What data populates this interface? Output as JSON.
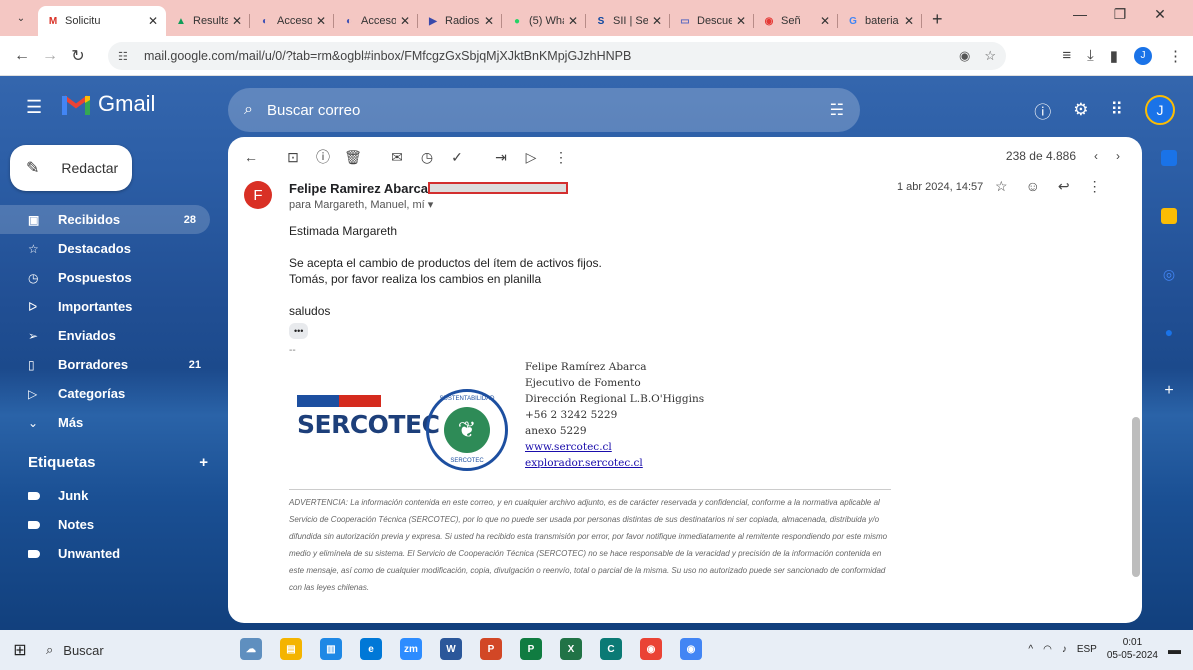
{
  "browser": {
    "tabs": [
      {
        "label": "Solicitu",
        "favicon": "gmail",
        "active": true
      },
      {
        "label": "Resulta",
        "favicon": "drive-icon"
      },
      {
        "label": "Acceso",
        "favicon": "swirl-icon"
      },
      {
        "label": "Acceso",
        "favicon": "swirl-icon"
      },
      {
        "label": "Radios",
        "favicon": "play-icon"
      },
      {
        "label": "(5) Wha",
        "favicon": "whatsapp-icon"
      },
      {
        "label": "SII | Ser",
        "favicon": "sii-icon"
      },
      {
        "label": "Descue",
        "favicon": "tag-icon"
      },
      {
        "label": "Señ",
        "favicon": "radio-icon"
      },
      {
        "label": "bateria",
        "favicon": "google-icon"
      }
    ],
    "url": "mail.google.com/mail/u/0/?tab=rm&ogbl#inbox/FMfcgzGxSbjqMjXJktBnKMpjGJzhHNPB"
  },
  "gmail": {
    "logo_text": "Gmail",
    "search_placeholder": "Buscar correo",
    "compose_label": "Redactar",
    "nav": [
      {
        "label": "Recibidos",
        "count": "28",
        "icon": "inbox-icon",
        "glyph": "▣",
        "active": true
      },
      {
        "label": "Destacados",
        "count": "",
        "icon": "star-icon",
        "glyph": "☆"
      },
      {
        "label": "Pospuestos",
        "count": "",
        "icon": "clock-icon",
        "glyph": "◷"
      },
      {
        "label": "Importantes",
        "count": "",
        "icon": "important-icon",
        "glyph": "ᐅ"
      },
      {
        "label": "Enviados",
        "count": "",
        "icon": "send-icon",
        "glyph": "➢"
      },
      {
        "label": "Borradores",
        "count": "21",
        "icon": "draft-icon",
        "glyph": "▯"
      },
      {
        "label": "Categorías",
        "count": "",
        "icon": "category-icon",
        "glyph": "▷"
      },
      {
        "label": "Más",
        "count": "",
        "icon": "chevron-down-icon",
        "glyph": "⌄"
      }
    ],
    "labels_heading": "Etiquetas",
    "labels": [
      "Junk",
      "Notes",
      "Unwanted"
    ],
    "pager": "238 de 4.886"
  },
  "message": {
    "sender_initial": "F",
    "sender_name": "Felipe Ramirez Abarca",
    "recipients": "para Margareth, Manuel, mí ▾",
    "date": "1 abr 2024, 14:57",
    "greeting": "Estimada Margareth",
    "line1": "Se acepta el cambio de productos del ítem de activos fijos.",
    "line2": "Tomás, por favor realiza los cambios en planilla",
    "closing": "saludos",
    "dash": "--",
    "signature": {
      "name": "Felipe Ramírez Abarca",
      "title": "Ejecutivo de Fomento",
      "office": "Dirección Regional L.B.O'Higgins",
      "phone": "+56 2 3242 5229",
      "extension": "anexo 5229",
      "web1": "www.sercotec.cl",
      "web2": "explorador.sercotec.cl",
      "logo_word": "SERCOTEC",
      "seal_top": "SUSTENTABILIDAD",
      "seal_bottom": "SERCOTEC"
    },
    "disclaimer": "ADVERTENCIA: La información contenida en este correo, y en cualquier archivo adjunto, es de carácter reservada y confidencial, conforme a la normativa aplicable al Servicio de Cooperación Técnica (SERCOTEC), por lo que no puede ser usada por personas distintas de sus destinatarios ni ser copiada, almacenada, distribuida y/o difundida sin autorización previa y expresa. Si usted ha recibido esta transmisión por error, por favor notifique inmediatamente al remitente respondiendo por este mismo medio y elimínela de su sistema. El Servicio de Cooperación Técnica (SERCOTEC) no se hace responsable de la veracidad y precisión de la información contenida en este mensaje, así como de cualquier modificación, copia, divulgación o reenvío, total o parcial de la misma. Su uso no autorizado puede ser sancionado de conformidad con las leyes chilenas."
  },
  "taskbar": {
    "search_label": "Buscar",
    "lang": "ESP",
    "time": "0:01",
    "date": "05-05-2024"
  },
  "colors": {
    "accent": "#1a73e8",
    "sender_avatar": "#d93025",
    "tabstrip": "#f4c7c3"
  }
}
